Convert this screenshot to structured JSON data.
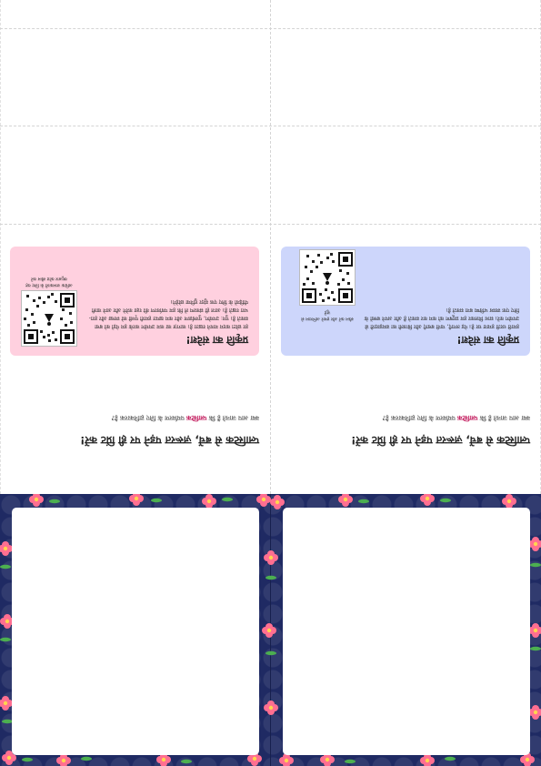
{
  "colors": {
    "pink_card": "#ffd0df",
    "blue_card": "#cdd6fb",
    "decor_background": "#1f2a63",
    "flower": "#ff6f91",
    "leaf": "#4caf50",
    "link": "#c2185b"
  },
  "panels": [
    {
      "headline": "प्लास्टिक से बचें, ज़रूरत पड़ने पर ही प्रिंट करें!",
      "subline_pre": "क्या आप जानते हैं कि ",
      "subline_link": "प्लास्टिक",
      "subline_post": " पर्यावरण के लिए हानिकारक है?",
      "card": {
        "title": "प्रकृति का संदेश!",
        "body": "हर छोटा कदम मायने रखता है। कागज़ का कम उपयोग करके हम पेड़ों को बचा सकते हैं। पुन: उपयोग, पुनर्चक्रण और कम खपत हमारी पृथ्वी को स्वच्छ और हरा-भरा रखते हैं। आज ही संकल्प लें कि हम पर्यावरण की रक्षा करेंगे और आने वाली पीढ़ियों के लिए एक सुंदर दुनिया छोड़ेंगे।",
        "qr_caption": "अधिक जानकारी के लिए यह क्यूआर कोड स्कैन करें"
      }
    },
    {
      "headline": "प्लास्टिक से बचें, ज़रूरत पड़ने पर ही प्रिंट करें!",
      "subline_pre": "क्या आप जानते हैं कि ",
      "subline_link": "प्लास्टिक",
      "subline_post": " पर्यावरण के लिए हानिकारक है?",
      "card": {
        "title": "प्रकृति का संदेश!",
        "body": "हमारी धरती हमारा घर है। पेड़ लगाएँ, पानी बचाएँ और बिजली का समझदारी से उपयोग करें। साथ मिलकर हम प्रदूषण को कम कर सकते हैं और अपने बच्चों के लिए एक स्वस्थ भविष्य बना सकते हैं।",
        "qr_caption": "स्कैन करें और हमारे अभियान से जुड़ें"
      }
    }
  ]
}
